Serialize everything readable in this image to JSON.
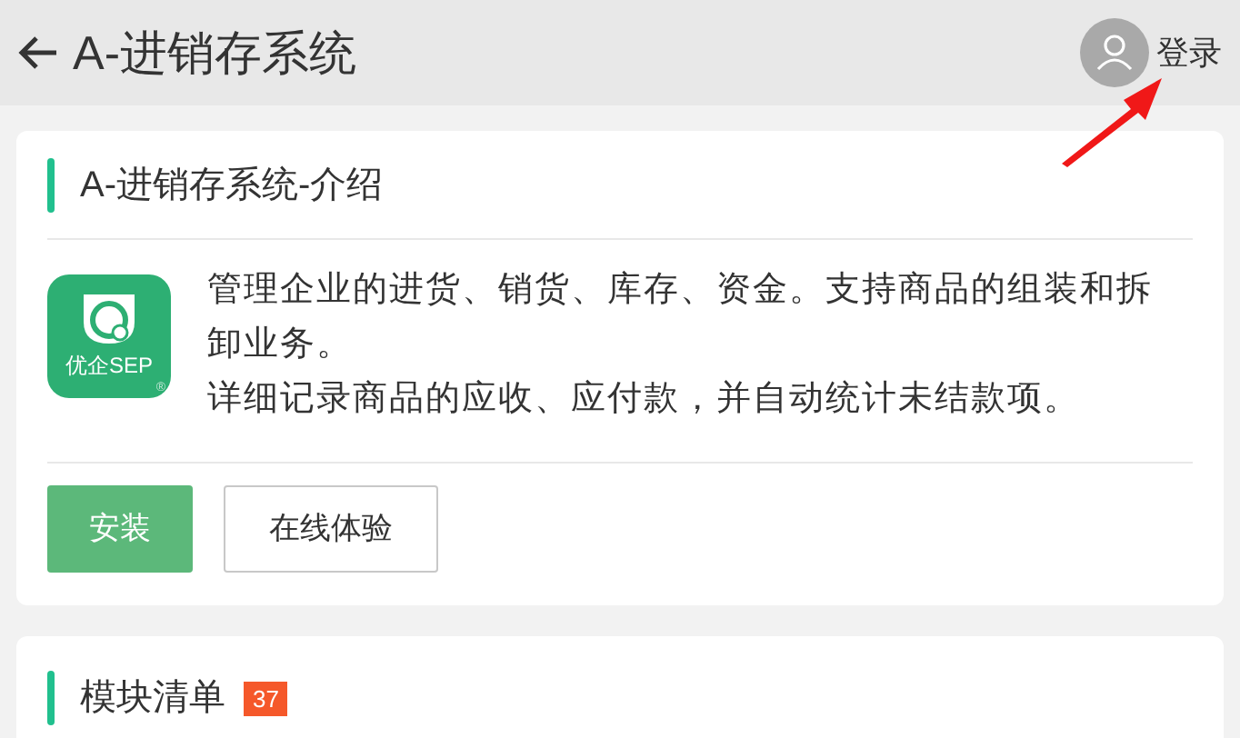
{
  "header": {
    "title": "A-进销存系统",
    "login": "登录"
  },
  "intro": {
    "title": "A-进销存系统-介绍",
    "logo_text": "优企SEP",
    "logo_mark": "®",
    "paragraphs": [
      "管理企业的进货、销货、库存、资金。支持商品的组装和拆卸业务。",
      "详细记录商品的应收、应付款，并自动统计未结款项。"
    ],
    "buttons": [
      {
        "label": "安装",
        "kind": "primary"
      },
      {
        "label": "在线体验",
        "kind": "secondary"
      }
    ]
  },
  "modules": {
    "title": "模块清单",
    "count": "37"
  }
}
